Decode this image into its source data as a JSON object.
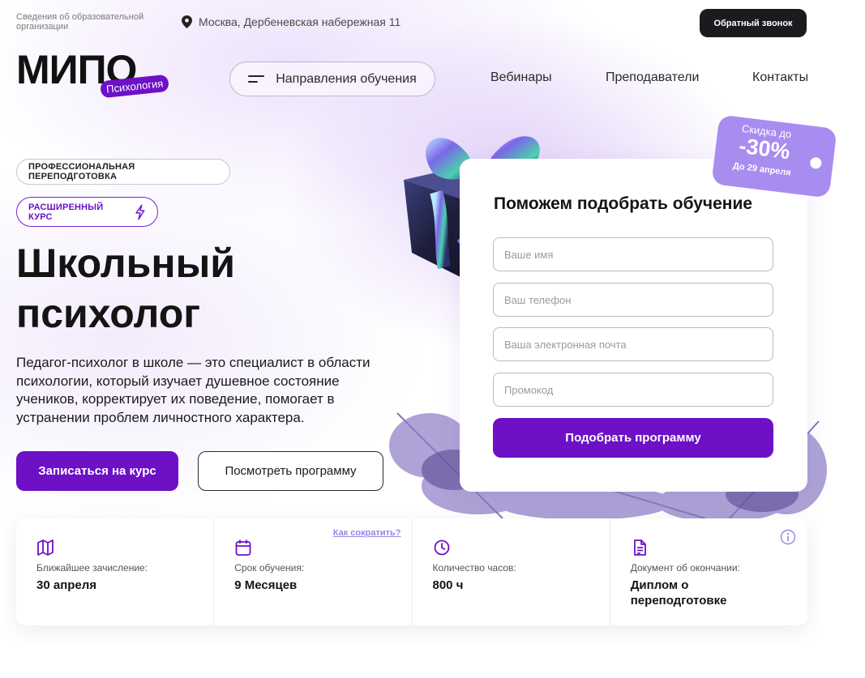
{
  "header": {
    "org_info": "Сведения об образовательной организации",
    "address": "Москва, Дербеневская набережная 11",
    "callback_label": "Обратный звонок",
    "logo_text": "МИПО",
    "logo_badge": "Психология",
    "directions_label": "Направления обучения",
    "nav": [
      "Вебинары",
      "Преподаватели",
      "Контакты"
    ]
  },
  "hero": {
    "tag_professional": "ПРОФЕССИОНАЛЬНАЯ ПЕРЕПОДГОТОВКА",
    "tag_extended": "РАСШИРЕННЫЙ КУРС",
    "title_line1": "Школьный",
    "title_line2": "психолог",
    "description": "Педагог-психолог в школе — это специалист в области психологии, который изучает душевное состояние учеников, корректирует их поведение, помогает в устранении проблем личностного характера.",
    "enroll_label": "Записаться на курс",
    "program_label": "Посмотреть программу"
  },
  "discount": {
    "line1": "Скидка до",
    "line2": "-30%",
    "line3": "До 29 апреля"
  },
  "form": {
    "title": "Поможем подобрать обучение",
    "name_placeholder": "Ваше имя",
    "phone_placeholder": "Ваш телефон",
    "email_placeholder": "Ваша электронная почта",
    "promo_placeholder": "Промокод",
    "submit_label": "Подобрать программу"
  },
  "info": {
    "enrollment_label": "Ближайшее зачисление:",
    "enrollment_value": "30 апреля",
    "duration_label": "Срок обучения:",
    "duration_value": "9 Месяцев",
    "shorten_link": "Как сократить?",
    "hours_label": "Количество часов:",
    "hours_value": "800 ч",
    "document_label": "Документ об окончании:",
    "document_value": "Диплом о переподготовке"
  },
  "colors": {
    "accent": "#6d10c6",
    "dark_button": "#1b1b1f",
    "discount_tag": "#a98cf0",
    "link": "#9a84e6"
  },
  "icons": [
    "location-pin-icon",
    "menu-icon",
    "lightning-icon",
    "map-icon",
    "calendar-icon",
    "clock-icon",
    "document-icon",
    "info-icon"
  ]
}
